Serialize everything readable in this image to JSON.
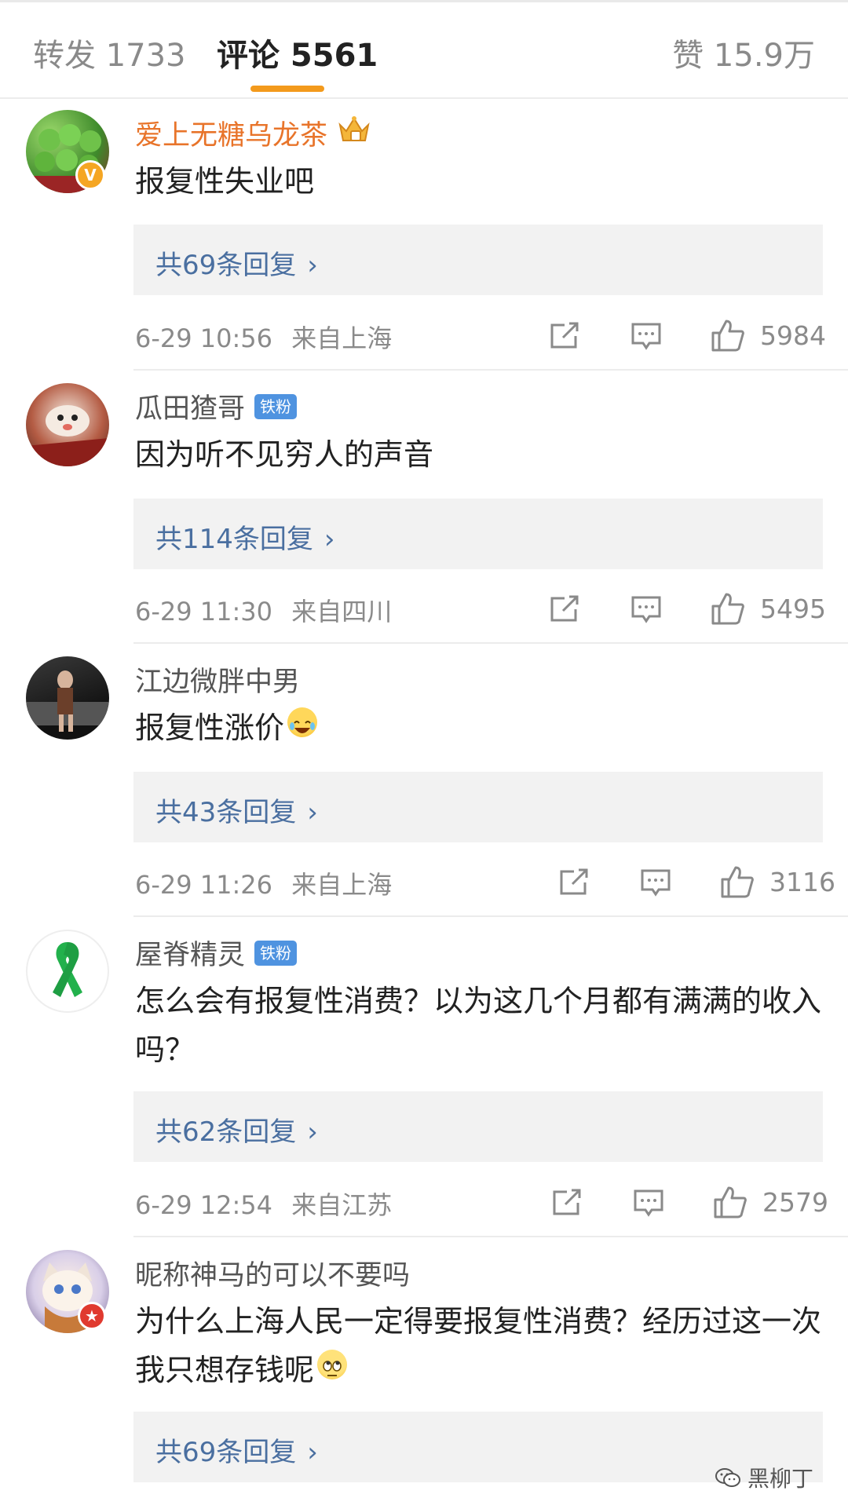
{
  "tabs": {
    "repost": "转发 1733",
    "comments": "评论 5561",
    "likes": "赞 15.9万"
  },
  "comments": [
    {
      "username": "爱上无糖乌龙茶",
      "content": "报复性失业吧",
      "reply_text": "共69条回复",
      "time": "6-29 10:56",
      "location": "来自上海",
      "likes": "5984"
    },
    {
      "username": "瓜田猹哥",
      "badge": "铁粉",
      "content": "因为听不见穷人的声音",
      "reply_text": "共114条回复",
      "time": "6-29 11:30",
      "location": "来自四川",
      "likes": "5495"
    },
    {
      "username": "江边微胖中男",
      "content": "报复性涨价",
      "reply_text": "共43条回复",
      "time": "6-29 11:26",
      "location": "来自上海",
      "likes": "3116"
    },
    {
      "username": "屋脊精灵",
      "badge": "铁粉",
      "content": "怎么会有报复性消费？以为这几个月都有满满的收入吗？",
      "reply_text": "共62条回复",
      "time": "6-29 12:54",
      "location": "来自江苏",
      "likes": "2579"
    },
    {
      "username": "昵称神马的可以不要吗",
      "content": "为什么上海人民一定得要报复性消费？经历过这一次我只想存钱呢",
      "reply_text": "共69条回复"
    }
  ],
  "watermark": "黑柳丁",
  "colors": {
    "accent_underline": "#f39a1c",
    "vip_name": "#e8742a",
    "reply_link": "#4a6fa0",
    "badge_blue": "#4f93e0"
  }
}
